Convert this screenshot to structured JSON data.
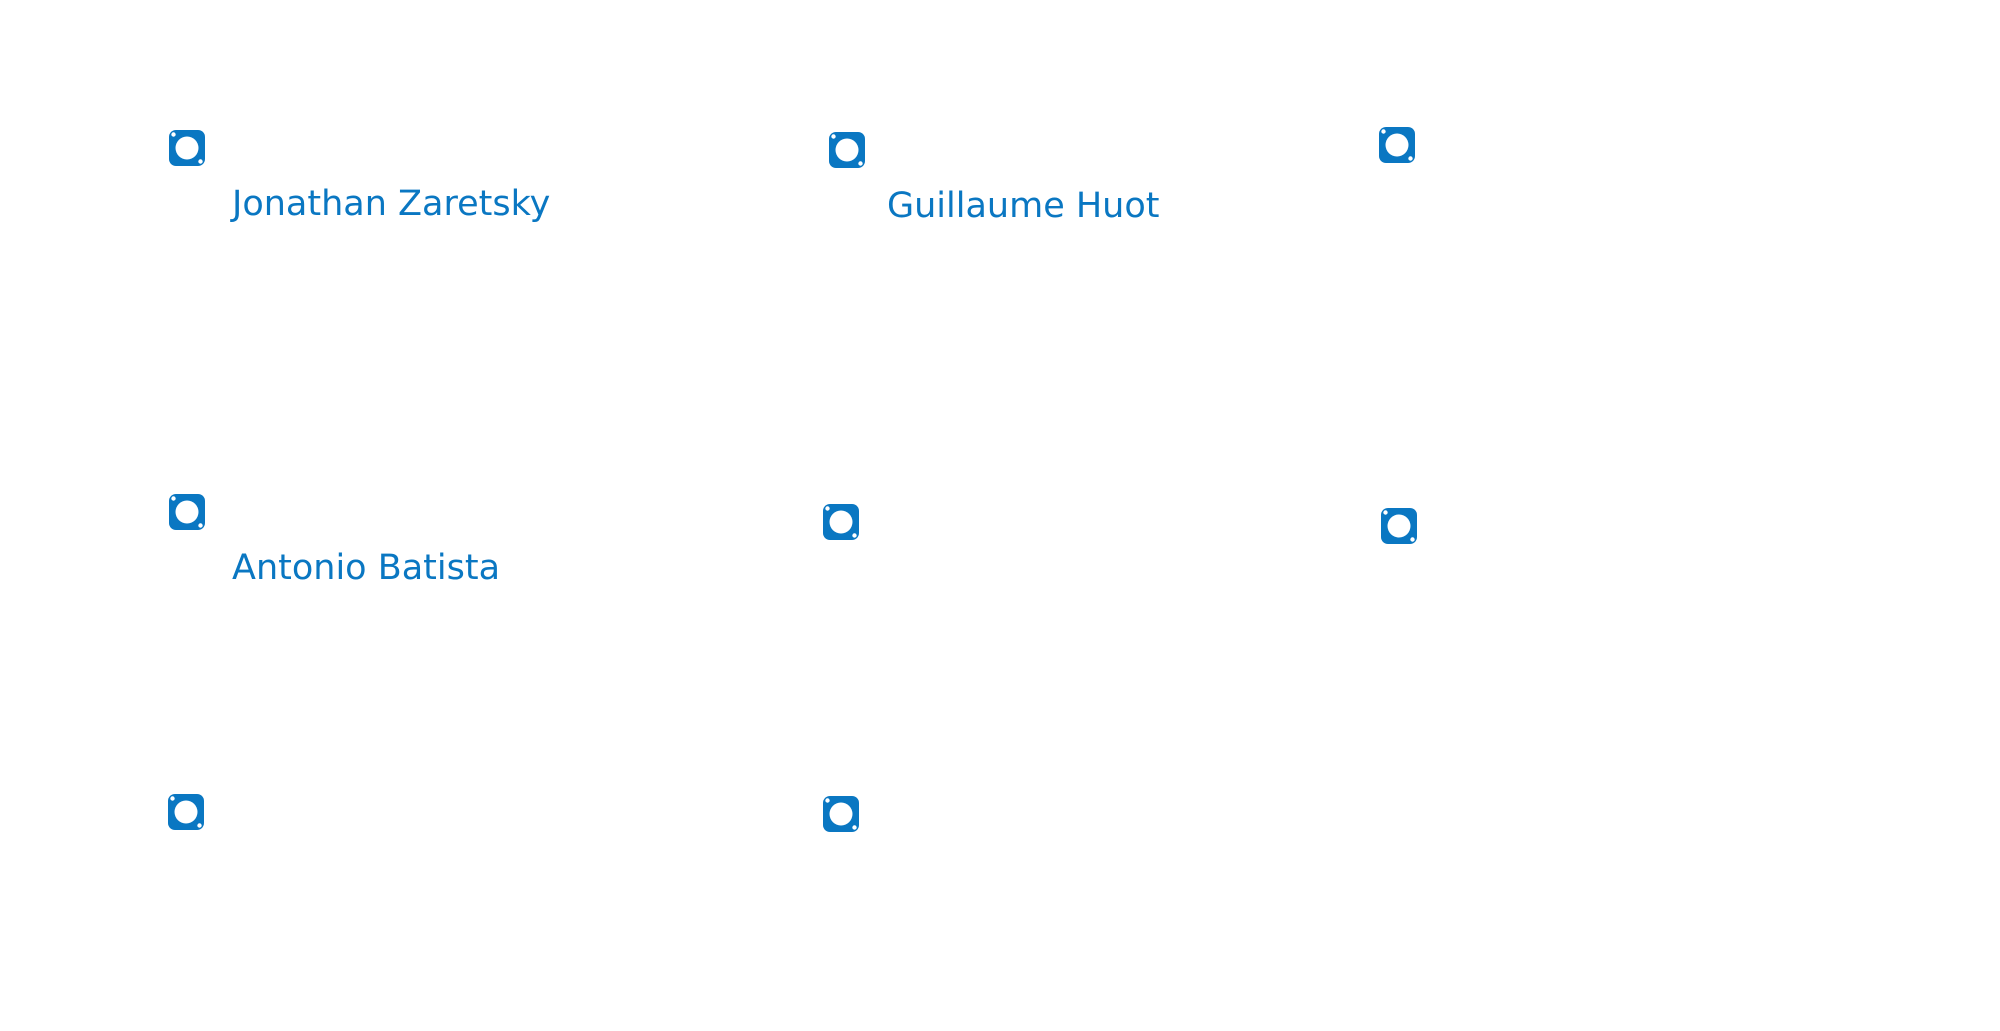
{
  "colors": {
    "accent": "#0a77c2",
    "background": "#ffffff"
  },
  "icon_name": "profile-badge-icon",
  "people": [
    {
      "name": "Jonathan Zaretsky"
    },
    {
      "name": "Guillaume Huot"
    },
    {
      "name": ""
    },
    {
      "name": "Antonio Batista"
    },
    {
      "name": ""
    },
    {
      "name": ""
    },
    {
      "name": ""
    },
    {
      "name": ""
    }
  ]
}
